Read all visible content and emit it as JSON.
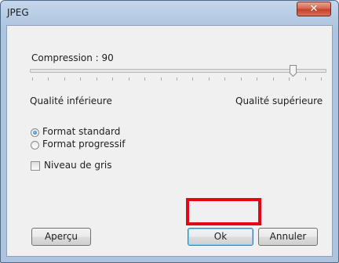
{
  "window": {
    "title": "JPEG",
    "close_symbol": "✕"
  },
  "compression": {
    "label": "Compression : 90",
    "value": 90,
    "tick_count": 19
  },
  "quality": {
    "low_label": "Qualité inférieure",
    "high_label": "Qualité supérieure"
  },
  "format_options": [
    {
      "label": "Format standard",
      "checked": true
    },
    {
      "label": "Format progressif",
      "checked": false
    }
  ],
  "grayscale": {
    "label": "Niveau de gris",
    "checked": false
  },
  "buttons": {
    "preview": "Aperçu",
    "ok": "Ok",
    "cancel": "Annuler"
  },
  "colors": {
    "highlight": "#e30613",
    "close_button": "#c4412d",
    "frame": "#b6cbe3"
  }
}
